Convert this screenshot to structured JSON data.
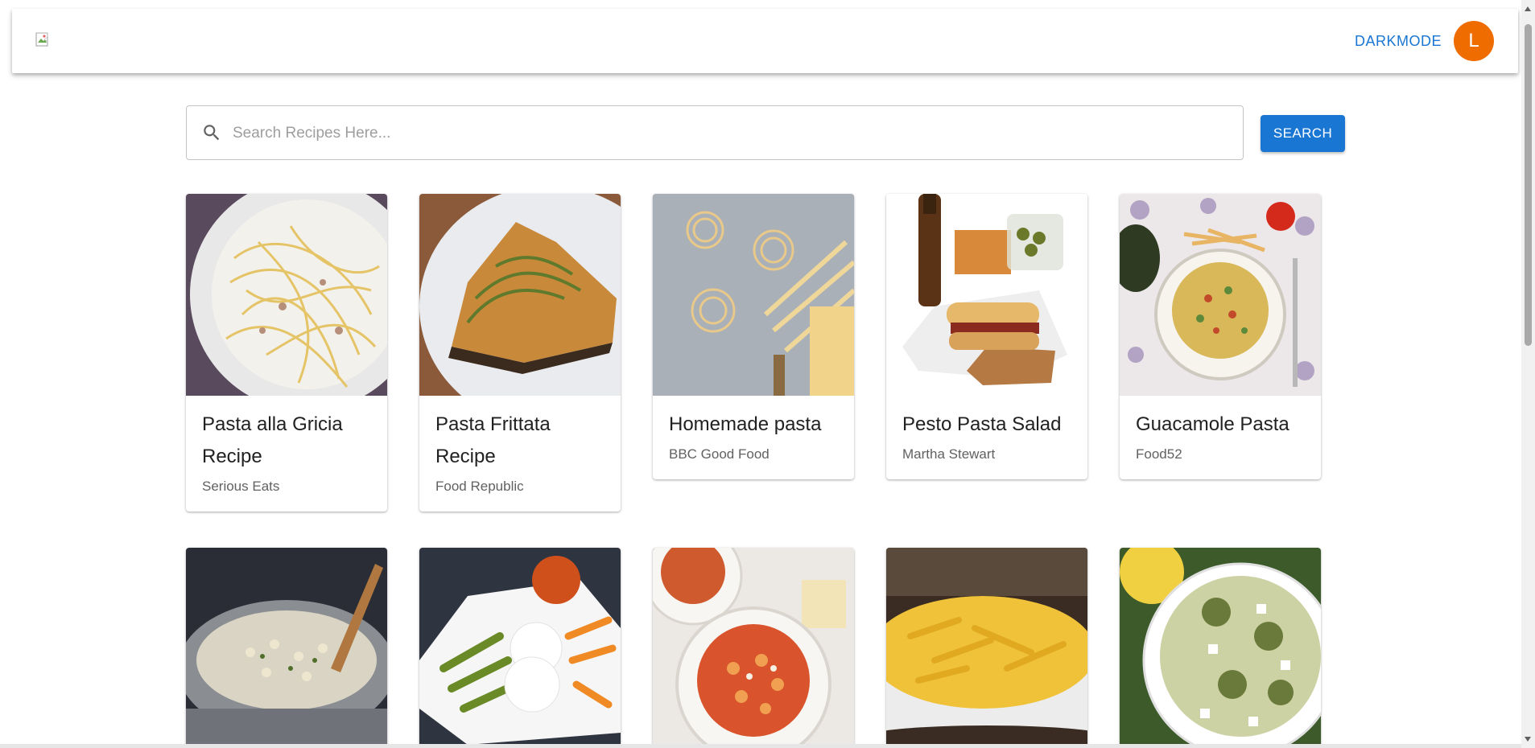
{
  "header": {
    "darkmode_label": "DARKMODE",
    "avatar_initial": "L",
    "avatar_color": "#ef6c00"
  },
  "search": {
    "placeholder": "Search Recipes Here...",
    "value": "",
    "button_label": "SEARCH",
    "button_color": "#1976d2"
  },
  "recipes": [
    {
      "title": "Pasta alla Gricia Recipe",
      "source": "Serious Eats",
      "image": "spaghetti-carbonara-photo"
    },
    {
      "title": "Pasta Frittata Recipe",
      "source": "Food Republic",
      "image": "pasta-frittata-photo"
    },
    {
      "title": "Homemade pasta",
      "source": "BBC Good Food",
      "image": "fresh-pasta-nests-photo"
    },
    {
      "title": "Pesto Pasta Salad",
      "source": "Martha Stewart",
      "image": "sandwich-picnic-photo"
    },
    {
      "title": "Guacamole Pasta",
      "source": "Food52",
      "image": "penne-bowl-photo"
    },
    {
      "title": "",
      "source": "",
      "image": "pasta-in-pot-photo"
    },
    {
      "title": "",
      "source": "",
      "image": "caprese-pasta-photo"
    },
    {
      "title": "",
      "source": "",
      "image": "rotini-tomato-photo"
    },
    {
      "title": "",
      "source": "",
      "image": "penne-cheese-sauce-photo"
    },
    {
      "title": "",
      "source": "",
      "image": "pesto-sausage-pasta-photo"
    }
  ]
}
